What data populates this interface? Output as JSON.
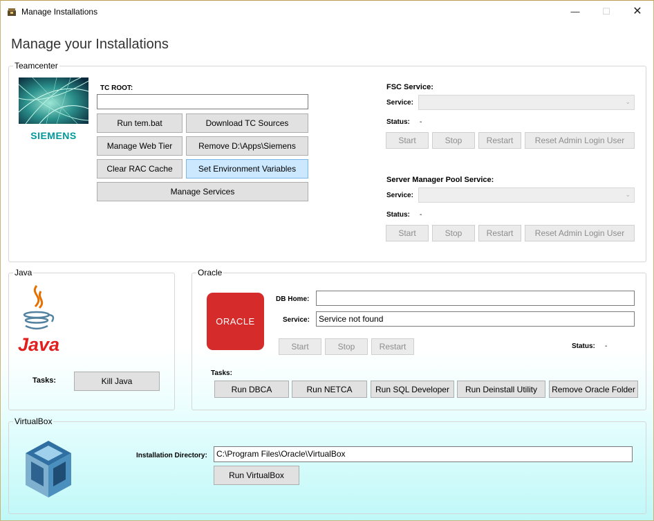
{
  "window": {
    "title": "Manage Installations",
    "min": "—",
    "max": "☐",
    "close": "✕"
  },
  "page": {
    "title": "Manage your Installations"
  },
  "teamcenter": {
    "group_label": "Teamcenter",
    "logo_text": "SIEMENS",
    "tc_root_label": "TC ROOT:",
    "tc_root_value": "",
    "buttons": {
      "run_tem": "Run tem.bat",
      "download_sources": "Download TC Sources",
      "manage_web_tier": "Manage Web Tier",
      "remove_dir": "Remove D:\\Apps\\Siemens",
      "clear_rac_cache": "Clear RAC Cache",
      "set_env_vars": "Set Environment Variables",
      "manage_services": "Manage Services"
    },
    "fsc": {
      "heading": "FSC Service:",
      "service_label": "Service:",
      "service_value": "",
      "status_label": "Status:",
      "status_value": "-",
      "start": "Start",
      "stop": "Stop",
      "restart": "Restart",
      "reset": "Reset Admin Login User"
    },
    "smp": {
      "heading": "Server Manager Pool Service:",
      "service_label": "Service:",
      "service_value": "",
      "status_label": "Status:",
      "status_value": "-",
      "start": "Start",
      "stop": "Stop",
      "restart": "Restart",
      "reset": "Reset Admin Login User"
    }
  },
  "java": {
    "group_label": "Java",
    "logo_text": "Java",
    "tasks_label": "Tasks:",
    "kill_java": "Kill Java"
  },
  "oracle": {
    "group_label": "Oracle",
    "logo_text": "ORACLE",
    "db_home_label": "DB Home:",
    "db_home_value": "",
    "service_label": "Service:",
    "service_value": "Service not found",
    "start": "Start",
    "stop": "Stop",
    "restart": "Restart",
    "status_label": "Status:",
    "status_value": "-",
    "tasks_label": "Tasks:",
    "tasks": {
      "dbca": "Run DBCA",
      "netca": "Run NETCA",
      "sql_developer": "Run SQL Developer",
      "deinstall": "Run Deinstall Utility",
      "remove_folder": "Remove Oracle Folder"
    }
  },
  "virtualbox": {
    "group_label": "VirtualBox",
    "install_dir_label": "Installation Directory:",
    "install_dir_value": "C:\\Program Files\\Oracle\\VirtualBox",
    "run": "Run VirtualBox"
  },
  "colors": {
    "highlight_button": "#cce8ff",
    "oracle_red": "#d52b2b",
    "siemens_teal": "#009999"
  }
}
